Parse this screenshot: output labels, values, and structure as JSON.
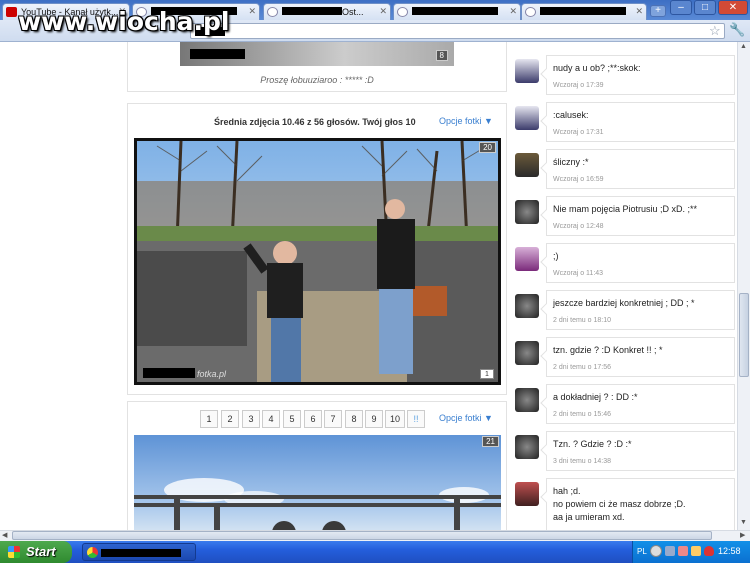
{
  "browser": {
    "tabs": [
      {
        "title": "YouTube - Kanał użytk...",
        "icon": "youtube-icon"
      },
      {
        "title": "",
        "icon": "page-icon"
      },
      {
        "title": "Ost...",
        "icon": "page-icon"
      },
      {
        "title": "",
        "icon": "page-icon"
      },
      {
        "title": "",
        "icon": "page-icon"
      }
    ],
    "new_tab": "+",
    "window_buttons": [
      "–",
      "□",
      "✕"
    ]
  },
  "watermark": "www.wiocha.pl",
  "photo_post": {
    "caption": "Proszę łobuuziaroo : ***** :D",
    "top_thumb_counter": "8",
    "rating": "Średnia zdjęcia 10.46 z 56 głosów. Twój głos 10",
    "options_label": "Opcje fotki ▼",
    "photo_counter": "20",
    "photo_watermark": "fotka.pl"
  },
  "voting": {
    "pages": [
      "1",
      "2",
      "3",
      "4",
      "5",
      "6",
      "7",
      "8",
      "9",
      "10",
      "!!"
    ],
    "options_label": "Opcje fotki ▼",
    "photo_counter": "21"
  },
  "comments": [
    {
      "text": "nudy a u ob? ;**:skok:",
      "time": "Wczoraj o 17:39"
    },
    {
      "text": ":calusek:",
      "time": "Wczoraj o 17:31"
    },
    {
      "text": "śliczny :*",
      "time": "Wczoraj o 16:59"
    },
    {
      "text": "Nie mam pojęcia Piotrusiu ;D xD. ;**",
      "time": "Wczoraj o 12:48"
    },
    {
      "text": ";)",
      "time": "Wczoraj o 11:43"
    },
    {
      "text": "jeszcze bardziej konkretniej ; DD ; *",
      "time": "2 dni temu o 18:10"
    },
    {
      "text": "tzn. gdzie ? :D Konkret !! ; *",
      "time": "2 dni temu o 17:56"
    },
    {
      "text": "a dokładniej ? : DD :*",
      "time": "2 dni temu o 15:46"
    },
    {
      "text": "Tzn. ? Gdzie ? :D :*",
      "time": "3 dni temu o 14:38"
    },
    {
      "text": "hah ;d.",
      "time": ""
    }
  ],
  "last_comment_lines": [
    "no powiem ci że masz dobrze ;D.",
    "aa ja umieram xd."
  ],
  "taskbar": {
    "start": "Start",
    "lang": "PL",
    "clock": "12:58"
  },
  "colors": {
    "link": "#3a7fd0",
    "taskbar": "#245edc",
    "start": "#2f8a2f"
  }
}
